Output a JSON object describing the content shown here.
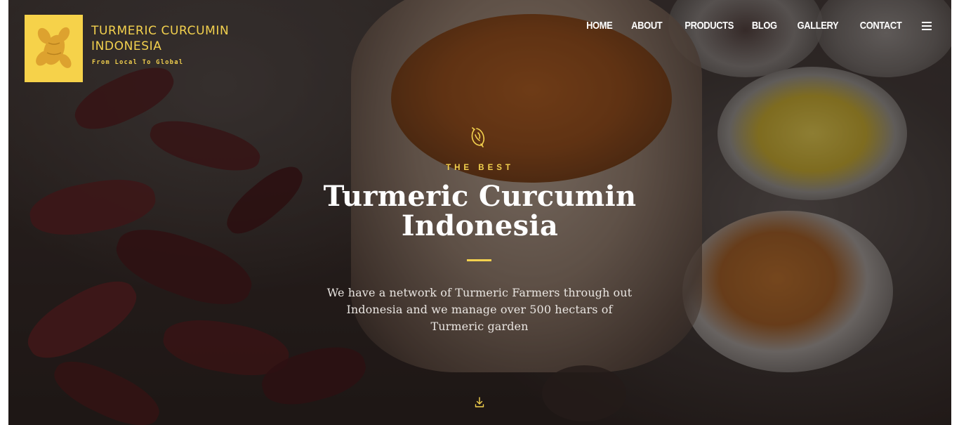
{
  "brand": {
    "title_line1": "TURMERIC CURCUMIN",
    "title_line2": "INDONESIA",
    "tagline": "From Local To Global",
    "logo_color": "#f6d24a"
  },
  "nav": {
    "items": [
      {
        "label": "HOME"
      },
      {
        "label": "ABOUT"
      },
      {
        "label": "PRODUCTS"
      },
      {
        "label": "BLOG"
      },
      {
        "label": "GALLERY"
      },
      {
        "label": "CONTACT"
      }
    ],
    "menu_icon": "hamburger-icon"
  },
  "hero": {
    "icon": "turmeric-root-icon",
    "eyebrow": "THE BEST",
    "title_line1": "Turmeric Curcumin",
    "title_line2": "Indonesia",
    "description": "We have a network of Turmeric Farmers through out Indonesia and we manage over 500 hectars of Turmeric garden",
    "scroll_icon": "scroll-down-icon"
  },
  "colors": {
    "accent": "#f3d14e",
    "text": "#ffffff"
  }
}
